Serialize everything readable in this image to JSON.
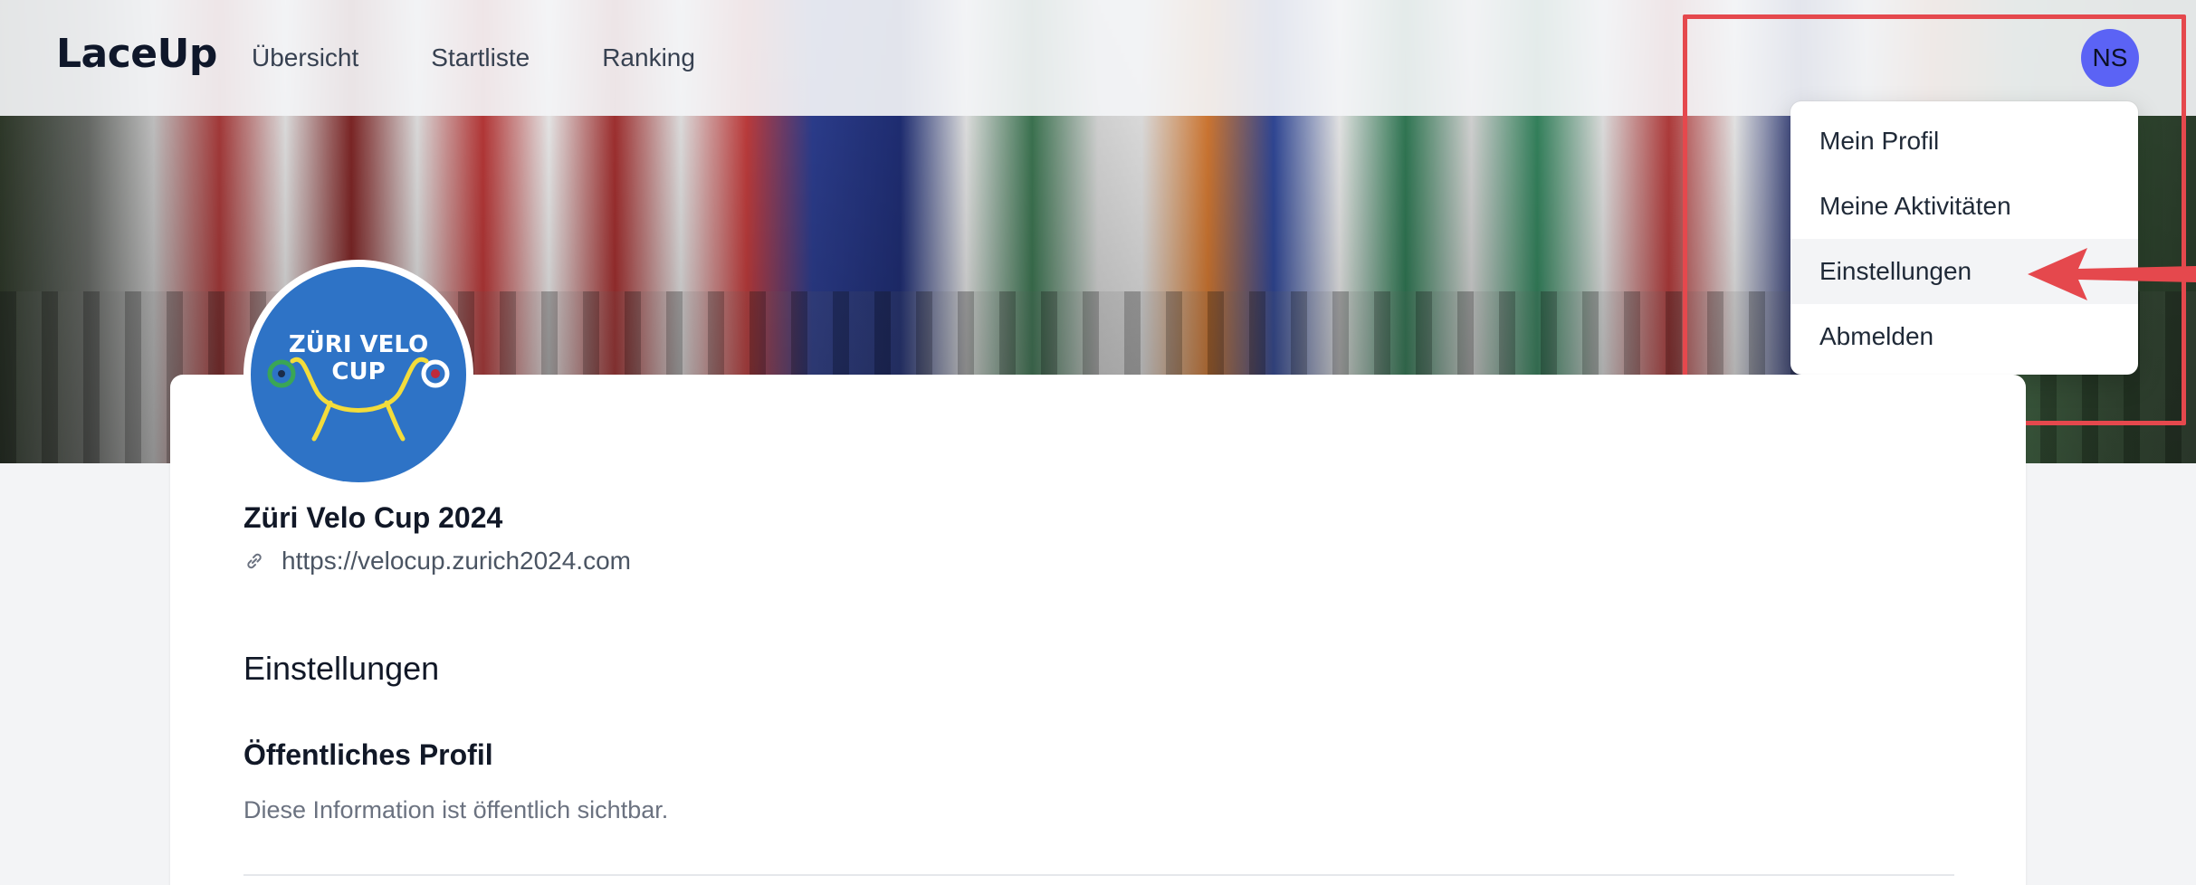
{
  "app": {
    "logo_text": "LaceUp"
  },
  "nav": {
    "items": [
      {
        "label": "Übersicht"
      },
      {
        "label": "Startliste"
      },
      {
        "label": "Ranking"
      }
    ]
  },
  "user_menu": {
    "avatar_initials": "NS",
    "items": [
      {
        "label": "Mein Profil"
      },
      {
        "label": "Meine Aktivitäten"
      },
      {
        "label": "Einstellungen",
        "active": true
      },
      {
        "label": "Abmelden"
      }
    ]
  },
  "organization": {
    "name": "Züri Velo Cup 2024",
    "url": "https://velocup.zurich2024.com",
    "logo_text_line1": "ZÜRI VELO",
    "logo_text_line2": "CUP"
  },
  "settings": {
    "title": "Einstellungen",
    "public_profile_title": "Öffentliches Profil",
    "public_profile_desc": "Diese Information ist öffentlich sichtbar."
  },
  "colors": {
    "highlight_red": "#e5484d",
    "avatar_bg": "#5b63f5",
    "logo_blue": "#2e73c6",
    "logo_yellow": "#f3dc3b"
  },
  "icons": {
    "link": "link-icon",
    "arrow": "arrow-left-icon"
  }
}
